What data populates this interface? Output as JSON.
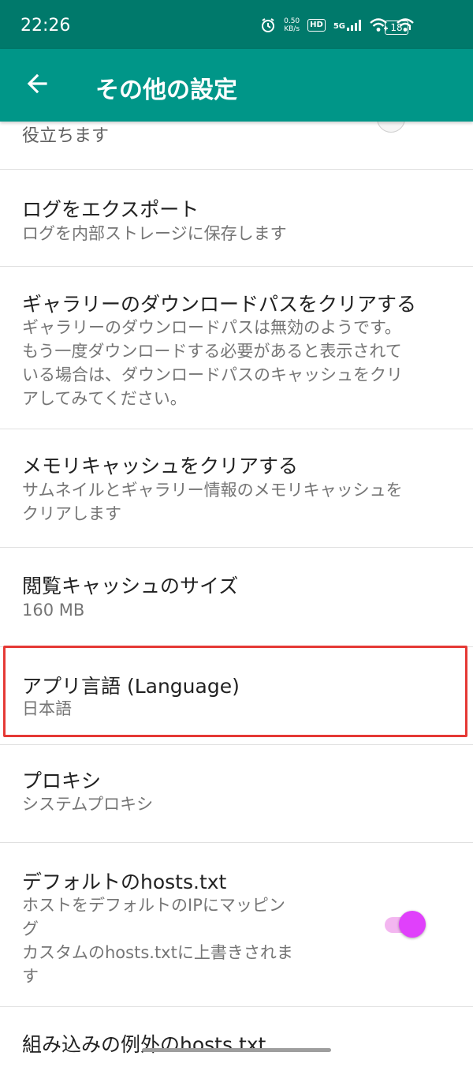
{
  "status_bar": {
    "time": "22:26",
    "net_speed_value": "0.50",
    "net_speed_unit": "KB/s",
    "hd_label": "HD",
    "network_label": "5G",
    "battery_level": "18"
  },
  "app_bar": {
    "title": "その他の設定"
  },
  "settings": {
    "top_partial": {
      "summary": "役立ちます"
    },
    "export_logs": {
      "title": "ログをエクスポート",
      "summary": "ログを内部ストレージに保存します"
    },
    "clear_download_path": {
      "title": "ギャラリーのダウンロードパスをクリアする",
      "summary_lines": [
        "ギャラリーのダウンロードパスは無効のようです。",
        "もう一度ダウンロードする必要があると表示されて",
        "いる場合は、ダウンロードパスのキャッシュをクリ",
        "アしてみてください。"
      ]
    },
    "clear_memory_cache": {
      "title": "メモリキャッシュをクリアする",
      "summary_lines": [
        "サムネイルとギャラリー情報のメモリキャッシュを",
        "クリアします"
      ]
    },
    "read_cache_size": {
      "title": "閲覧キャッシュのサイズ",
      "summary": "160 MB"
    },
    "app_language": {
      "title": "アプリ言語 (Language)",
      "summary": "日本語"
    },
    "proxy": {
      "title": "プロキシ",
      "summary": "システムプロキシ"
    },
    "default_hosts": {
      "title": "デフォルトのhosts.txt",
      "summary_lines": [
        "ホストをデフォルトのIPにマッピン",
        "グ",
        "カスタムのhosts.txtに上書きされま",
        "す"
      ],
      "enabled": true
    },
    "builtin_exceptions": {
      "title": "組み込みの例外のhosts.txt"
    }
  },
  "colors": {
    "status_bar": "#00796b",
    "app_bar": "#009688",
    "toggle_accent": "#e040fb",
    "highlight_border": "#e53935"
  }
}
